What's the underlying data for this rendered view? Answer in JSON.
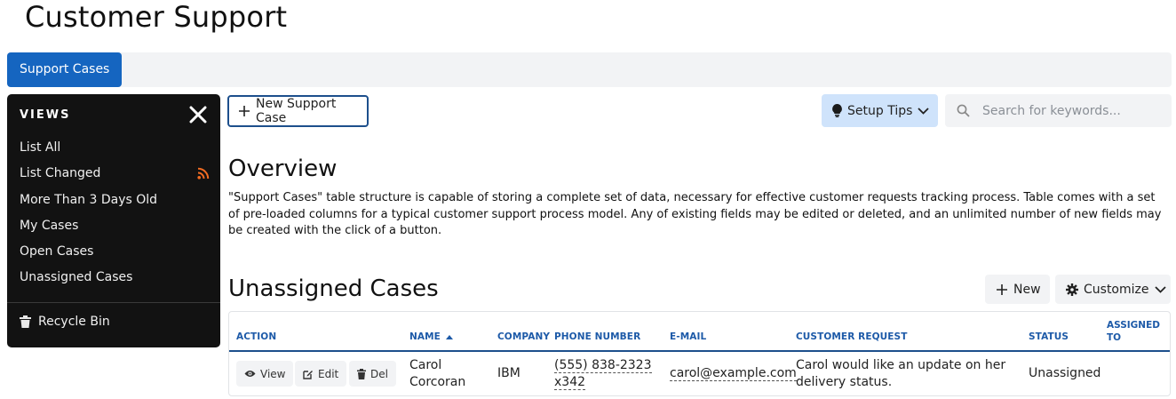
{
  "app": {
    "title": "Customer Support"
  },
  "tabs": [
    {
      "label": "Support Cases",
      "active": true
    }
  ],
  "sidebar": {
    "heading": "VIEWS",
    "items": [
      {
        "label": "List All"
      },
      {
        "label": "List Changed",
        "icon": "rss-icon"
      },
      {
        "label": "More Than 3 Days Old"
      },
      {
        "label": "My Cases"
      },
      {
        "label": "Open Cases"
      },
      {
        "label": "Unassigned Cases"
      }
    ],
    "recycle_label": "Recycle Bin"
  },
  "toolbar": {
    "new_case_label": "New Support Case",
    "setup_tips_label": "Setup Tips",
    "search_placeholder": "Search for keywords..."
  },
  "overview": {
    "title": "Overview",
    "text": "\"Support Cases\" table structure is capable of storing a complete set of data, necessary for effective customer requests tracking process. Table comes with a set of pre-loaded columns for a typical customer support process model. Any of existing fields may be edited or deleted, and an unlimited number of new fields may be created with the click of a button."
  },
  "section": {
    "title": "Unassigned Cases",
    "new_label": "New",
    "customize_label": "Customize"
  },
  "table": {
    "headers": {
      "action": "ACTION",
      "name": "NAME",
      "company": "COMPANY",
      "phone": "PHONE NUMBER",
      "email": "E-MAIL",
      "request": "CUSTOMER REQUEST",
      "status": "STATUS",
      "assigned": "ASSIGNED TO"
    },
    "sort": {
      "column": "name",
      "direction": "asc"
    },
    "row_actions": {
      "view": "View",
      "edit": "Edit",
      "del": "Del"
    },
    "rows": [
      {
        "name_line1": "Carol",
        "name_line2": "Corcoran",
        "company": "IBM",
        "phone_line1": "(555) 838-2323",
        "phone_line2": "x342",
        "email": "carol@example.com",
        "request_line1": "Carol would like an update on her",
        "request_line2": "delivery status.",
        "status": "Unassigned",
        "assigned_to": ""
      }
    ]
  },
  "colors": {
    "accent": "#1565c0",
    "header_text": "#1d5aa8",
    "sidebar_bg": "#121212",
    "tips_bg": "#cfe3fb",
    "rss": "#f26c22"
  }
}
